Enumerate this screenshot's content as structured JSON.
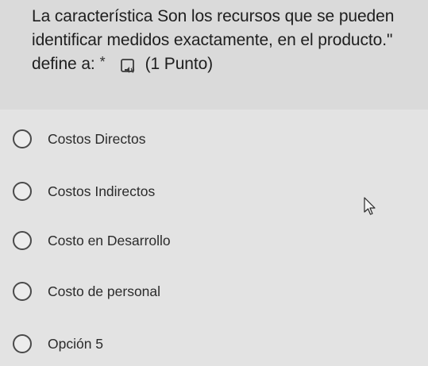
{
  "question": {
    "line1": "La característica Son los recursos que se pueden",
    "line2": "identificar medidos exactamente, en el producto.\"",
    "line3": "define a:",
    "required_marker": "*",
    "points": "(1 Punto)"
  },
  "options": [
    {
      "label": "Costos Directos",
      "selected": false
    },
    {
      "label": "Costos Indirectos",
      "selected": false
    },
    {
      "label": "Costo en Desarrollo",
      "selected": false
    },
    {
      "label": "Costo de personal",
      "selected": false
    },
    {
      "label": "Opción 5",
      "selected": false
    }
  ],
  "icons": {
    "reader": "immersive-reader-icon",
    "cursor": "mouse-pointer-icon",
    "radio": "radio-button-icon"
  },
  "colors": {
    "background": "#e3e3e3",
    "header_background": "#dadada",
    "text": "#1e1e1e",
    "radio_border": "#4a4a4a"
  }
}
